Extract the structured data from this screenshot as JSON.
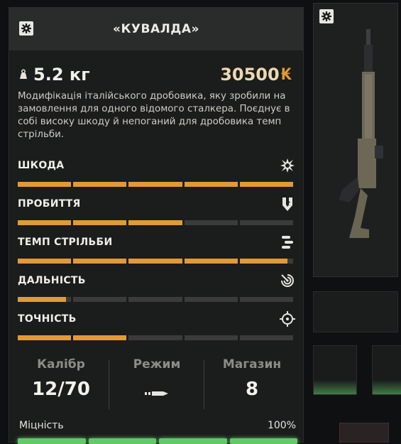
{
  "colors": {
    "accent": "#e29a36",
    "bar_empty": "#3a3b3a",
    "durability": "#62c968",
    "panel_bg": "#1b1c1c",
    "title_bg": "#2a2c2c"
  },
  "item": {
    "title": "«КУВАЛДА»",
    "weight": "5.2 кг",
    "weight_icon": "weight-icon",
    "price": "30500",
    "currency": "₭",
    "description": "Модифікація італійського дробовика, яку зробили на замовлення для одного відомого сталкера. Поєднує в собі високу шкоду й непоганий для дробовика темп стрільби."
  },
  "stats": [
    {
      "label": "ШКОДА",
      "icon": "explosion-icon",
      "value": 1.0
    },
    {
      "label": "ПРОБИТТЯ",
      "icon": "penetration-icon",
      "value": 0.6
    },
    {
      "label": "ТЕМП СТРІЛЬБИ",
      "icon": "fire-rate-icon",
      "value": 0.98
    },
    {
      "label": "ДАЛЬНІСТЬ",
      "icon": "range-icon",
      "value": 0.18
    },
    {
      "label": "ТОЧНІСТЬ",
      "icon": "crosshair-icon",
      "value": 0.4
    }
  ],
  "info": {
    "caliber_label": "Калібр",
    "caliber_value": "12/70",
    "mode_label": "Режим",
    "mode_icon": "single-bullet-icon",
    "magazine_label": "Магазин",
    "magazine_value": "8"
  },
  "durability": {
    "label": "Міцність",
    "value": "100%",
    "level": 1.0
  }
}
